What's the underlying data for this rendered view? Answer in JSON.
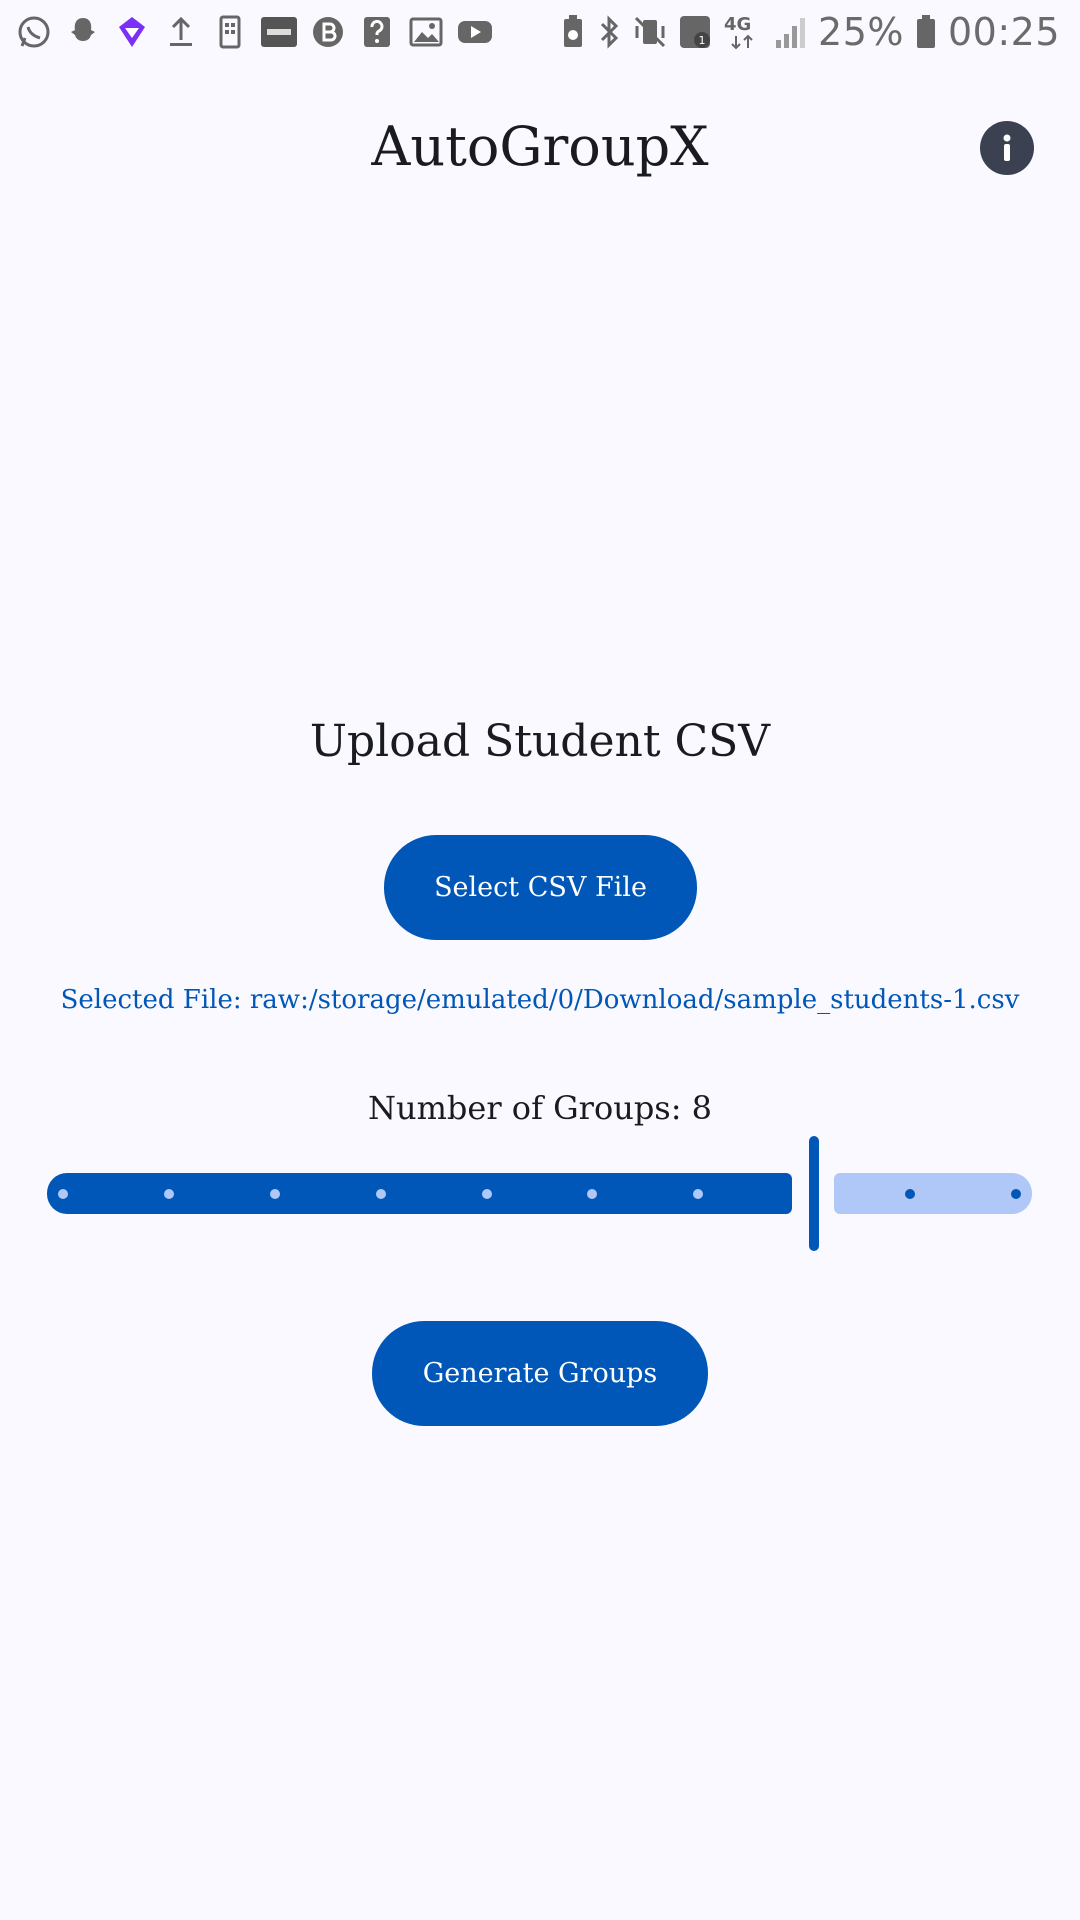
{
  "status_bar": {
    "left_icons": [
      "whatsapp-icon",
      "snapchat-icon",
      "crypto-app-icon",
      "upload-icon",
      "phone-app-icon",
      "bybit-icon",
      "bitcoin-icon",
      "help-icon",
      "image-icon",
      "youtube-icon"
    ],
    "right_icons": [
      "battery-saver-icon",
      "bluetooth-icon",
      "vibrate-mute-icon",
      "wifi-calling-icon",
      "network-4g-icon",
      "signal-icon",
      "battery-icon"
    ],
    "network": "4G",
    "battery": "25%",
    "time": "00:25"
  },
  "app_bar": {
    "title": "AutoGroupX",
    "info_icon": "info-icon"
  },
  "main": {
    "section_title": "Upload Student CSV",
    "select_button": "Select CSV File",
    "selected_file": "Selected File: raw:/storage/emulated/0/Download/sample_students-1.csv",
    "groups_label": "Number of Groups: 8",
    "slider": {
      "min": 1,
      "max": 10,
      "value": 8,
      "steps": 10
    },
    "generate_button": "Generate Groups"
  },
  "colors": {
    "primary": "#0057b7",
    "track_inactive": "#b0c8f8",
    "background": "#f9f9ff",
    "info_button": "#3b4150"
  }
}
